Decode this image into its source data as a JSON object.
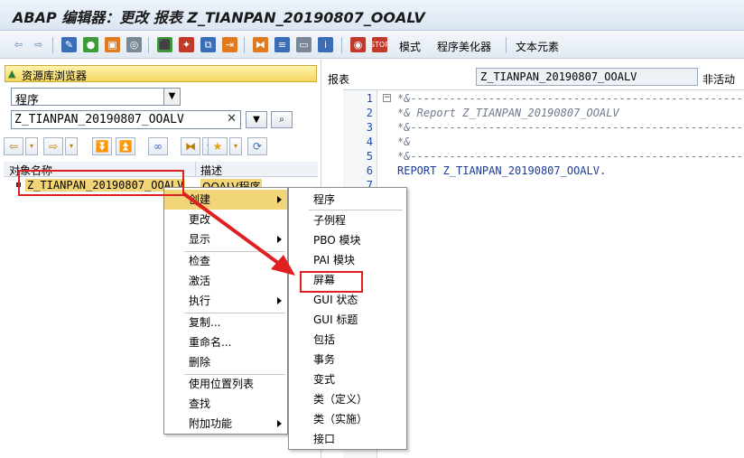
{
  "window": {
    "title": "ABAP 编辑器：更改 报表 Z_TIANPAN_20190807_OOALV"
  },
  "toolbar": {
    "mode_label": "模式",
    "pretty_printer_label": "程序美化器",
    "text_elements_label": "文本元素",
    "colors": {
      "blue": "#3a6fb8",
      "green": "#3f9a3a",
      "orange": "#e07a1f",
      "red": "#c0392b",
      "gray": "#7a8797"
    }
  },
  "repository_browser": {
    "title": "资源库浏览器",
    "object_type": "程序",
    "object_name": "Z_TIANPAN_20190807_OOALV",
    "columns": {
      "name": "对象名称",
      "desc": "描述"
    },
    "tree": [
      {
        "name": "Z_TIANPAN_20190807_OOALV",
        "desc": "OOALV程序"
      }
    ]
  },
  "editor": {
    "type_label": "报表",
    "program_name": "Z_TIANPAN_20190807_OOALV",
    "status": "非活动",
    "lines": [
      {
        "no": "1",
        "text": "*&---------------------------------------------------",
        "kind": "cmt"
      },
      {
        "no": "2",
        "text": "*& Report Z_TIANPAN_20190807_OOALV",
        "kind": "cmt"
      },
      {
        "no": "3",
        "text": "*&---------------------------------------------------",
        "kind": "cmt"
      },
      {
        "no": "4",
        "text": "*&",
        "kind": "cmt"
      },
      {
        "no": "5",
        "text": "*&---------------------------------------------------",
        "kind": "cmt"
      },
      {
        "no": "6",
        "text": "REPORT Z_TIANPAN_20190807_OOALV.",
        "kind": "kw"
      },
      {
        "no": "7",
        "text": "",
        "kind": "kw"
      }
    ]
  },
  "context_menu": {
    "items": [
      "创建",
      "更改",
      "显示",
      "检查",
      "激活",
      "执行",
      "复制...",
      "重命名...",
      "删除",
      "使用位置列表",
      "查找",
      "附加功能"
    ]
  },
  "create_submenu": {
    "items": [
      "程序",
      "子例程",
      "PBO 模块",
      "PAI 模块",
      "屏幕",
      "GUI 状态",
      "GUI 标题",
      "包括",
      "事务",
      "变式",
      "类（定义）",
      "类（实施）",
      "接口"
    ]
  }
}
